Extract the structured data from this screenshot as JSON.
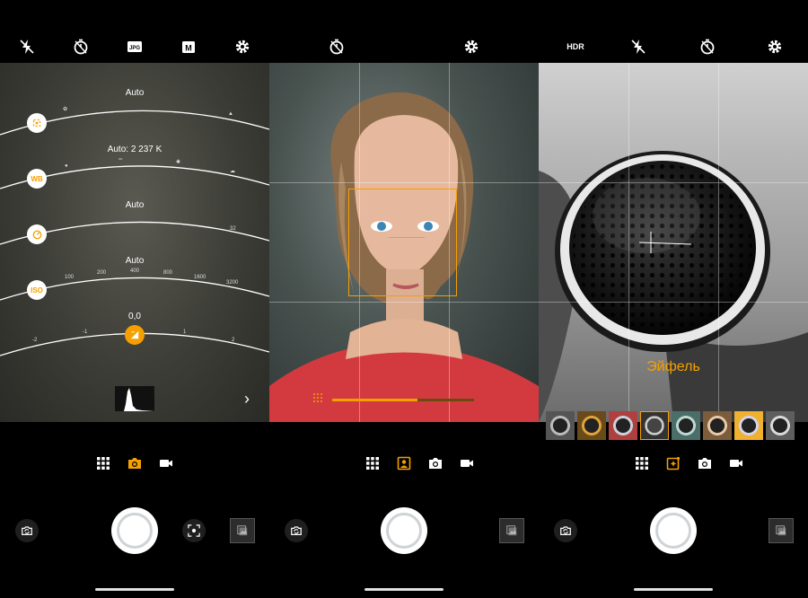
{
  "screen1": {
    "dials": [
      {
        "name": "focus",
        "label": "Auto"
      },
      {
        "name": "white-balance",
        "label": "Auto: 2 237 K",
        "button_text": "WB"
      },
      {
        "name": "shutter",
        "label": "Auto",
        "tick_max": "32"
      },
      {
        "name": "iso",
        "label": "Auto",
        "button_text": "ISO",
        "ticks": [
          "100",
          "200",
          "400",
          "800",
          "1600",
          "3200"
        ]
      },
      {
        "name": "exposure",
        "label": "0,0",
        "ticks": [
          "-2",
          "-1",
          "1",
          "2"
        ]
      }
    ]
  },
  "screen3": {
    "filter_name": "Эйфель",
    "hdr_label": "HDR"
  },
  "colors": {
    "accent": "#f5a000",
    "background": "#000000"
  },
  "icons": {
    "top1": [
      "flash-off-icon",
      "timer-icon",
      "jpg-format-icon",
      "manual-mode-icon",
      "gear-icon"
    ],
    "top2": [
      "timer-icon",
      "gear-icon"
    ],
    "top3": [
      "hdr-icon",
      "flash-off-icon",
      "timer-icon",
      "gear-icon"
    ],
    "modes": [
      "grid-menu-icon",
      "portrait-mode-icon",
      "camera-icon",
      "video-icon",
      "filter-mode-icon"
    ]
  },
  "screen2": {
    "bokeh_level": 0.6
  }
}
